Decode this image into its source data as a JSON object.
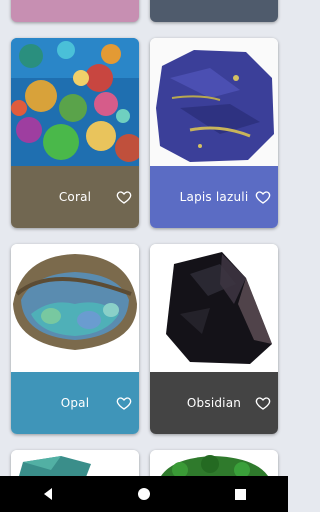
{
  "cards": [
    {
      "name": "Coral",
      "color": "#716751"
    },
    {
      "name": "Lapis lazuli",
      "color": "#5b6cc4"
    },
    {
      "name": "Opal",
      "color": "#3f95b9"
    },
    {
      "name": "Obsidian",
      "color": "#444444"
    }
  ],
  "partial_cards": {
    "top_left_color": "#c78fb2",
    "top_right_color": "#4f5b6c"
  },
  "icons": {
    "favorite": "heart-outline-icon",
    "nav_back": "back-triangle-icon",
    "nav_home": "home-circle-icon",
    "nav_recents": "recents-square-icon"
  }
}
